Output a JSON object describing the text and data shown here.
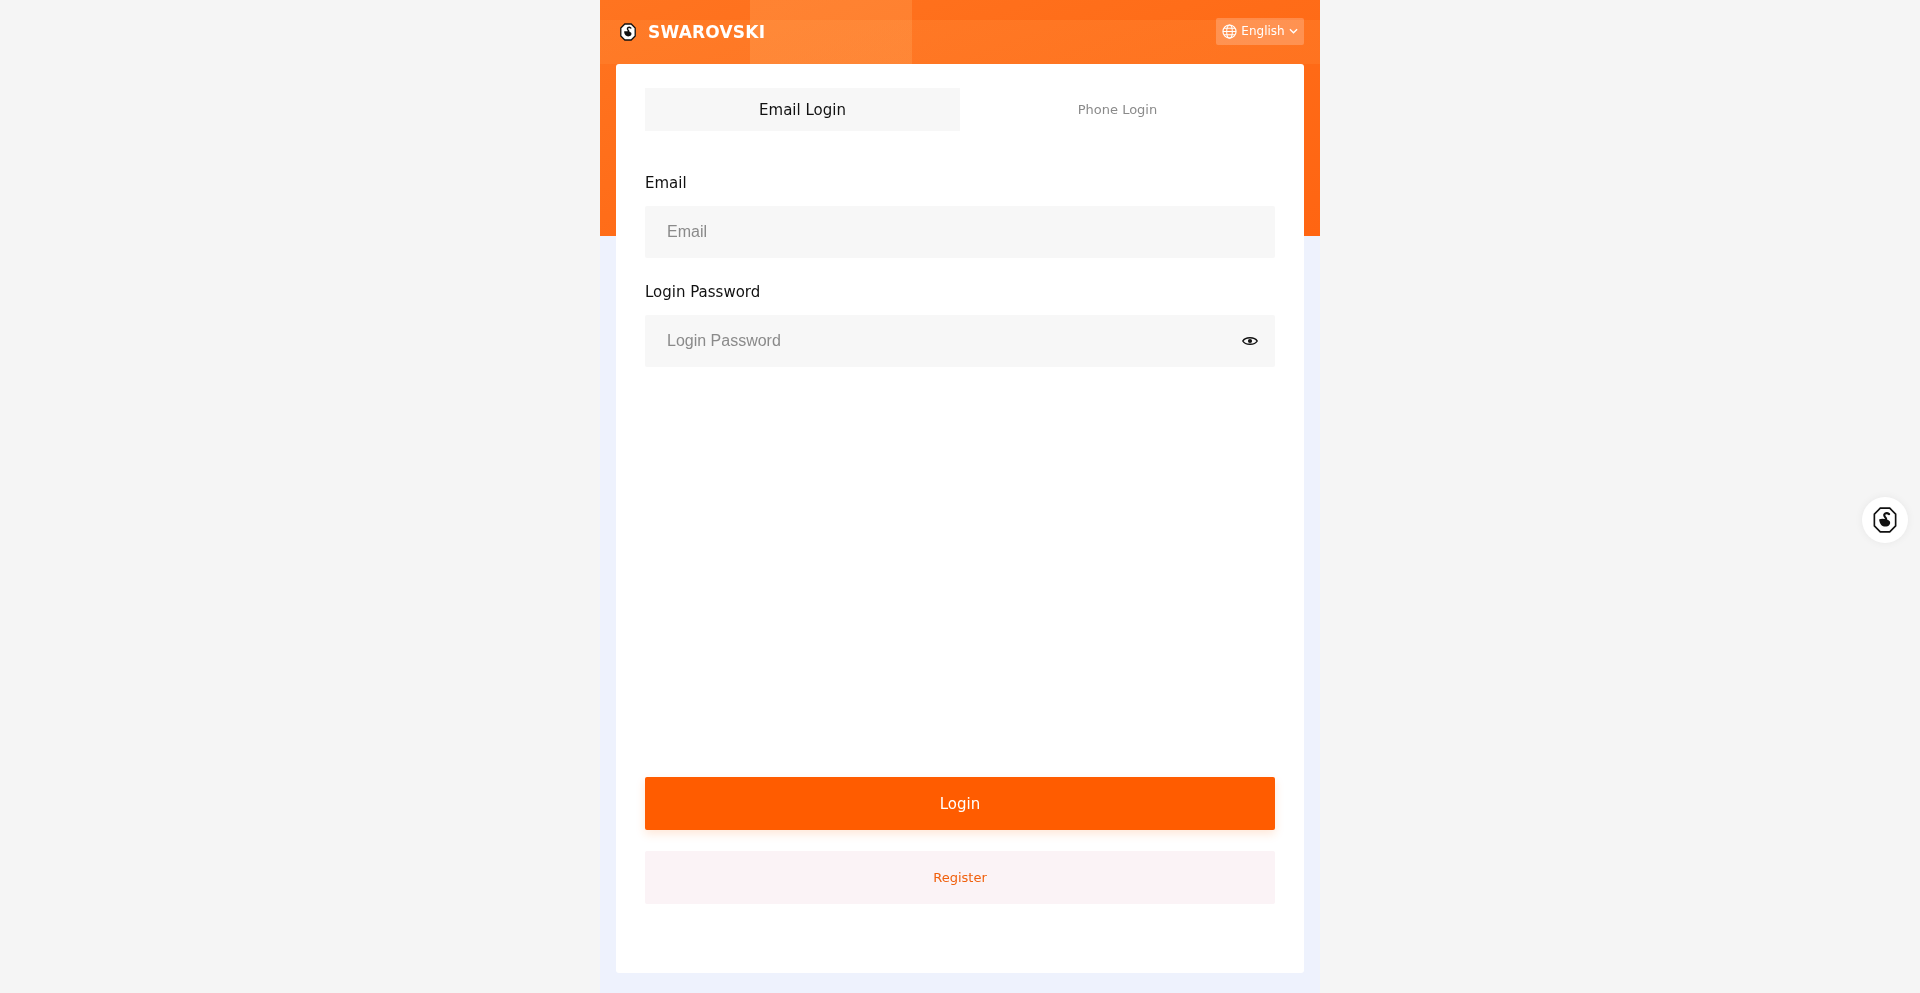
{
  "header": {
    "brand": "SWAROVSKI",
    "language": "English"
  },
  "tabs": [
    {
      "label": "Email Login",
      "selected": true
    },
    {
      "label": "Phone Login",
      "selected": false
    }
  ],
  "fields": [
    {
      "label": "Email",
      "placeholder": "Email",
      "kind": "text"
    },
    {
      "label": "Login Password",
      "placeholder": "Login Password",
      "kind": "password"
    }
  ],
  "buttons": [
    {
      "label": "Login",
      "kind": "primary"
    },
    {
      "label": "Register",
      "kind": "secondary"
    }
  ]
}
